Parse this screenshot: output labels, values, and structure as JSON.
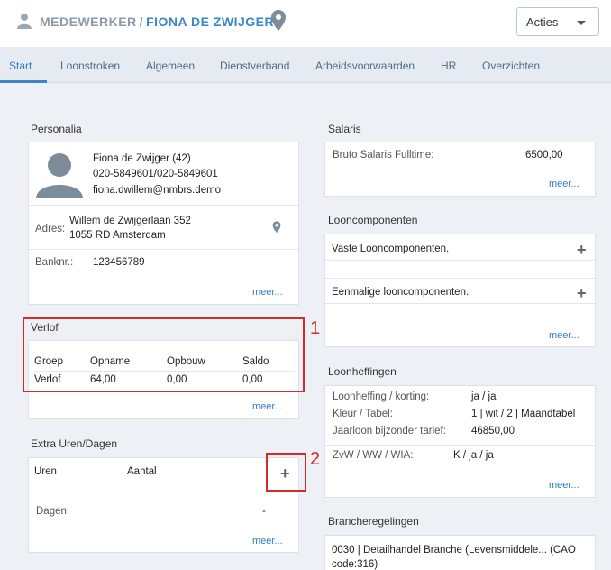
{
  "header": {
    "breadcrumb_root": "MEDEWERKER",
    "breadcrumb_sep": "/",
    "breadcrumb_current": "FIONA DE ZWIJGER",
    "acties_label": "Acties"
  },
  "tabs": [
    "Start",
    "Loonstroken",
    "Algemeen",
    "Dienstverband",
    "Arbeidsvoorwaarden",
    "HR",
    "Overzichten"
  ],
  "personalia": {
    "title": "Personalia",
    "name": "Fiona de Zwijger (42)",
    "phone": "020-5849601/020-5849601",
    "email": "fiona.dwillem@nmbrs.demo",
    "adres_label": "Adres:",
    "adres_line1": "Willem de Zwijgerlaan 352",
    "adres_line2": "1055 RD Amsterdam",
    "bank_label": "Banknr.:",
    "bank_value": "123456789",
    "meer": "meer..."
  },
  "verlof": {
    "title": "Verlof",
    "headers": [
      "Groep",
      "Opname",
      "Opbouw",
      "Saldo"
    ],
    "row": [
      "Verlof",
      "64,00",
      "0,00",
      "0,00"
    ],
    "meer": "meer..."
  },
  "extra": {
    "title": "Extra Uren/Dagen",
    "col_uren": "Uren",
    "col_aantal": "Aantal",
    "dagen_label": "Dagen:",
    "dagen_value": "-",
    "meer": "meer..."
  },
  "salaris": {
    "title": "Salaris",
    "label": "Bruto Salaris Fulltime:",
    "value": "6500,00",
    "meer": "meer..."
  },
  "looncomponenten": {
    "title": "Looncomponenten",
    "vaste": "Vaste Looncomponenten.",
    "eenmalige": "Eenmalige looncomponenten.",
    "meer": "meer..."
  },
  "loonheffingen": {
    "title": "Loonheffingen",
    "rows": [
      {
        "label": "Loonheffing / korting:",
        "value": "ja / ja"
      },
      {
        "label": "Kleur / Tabel:",
        "value": "1 | wit / 2 | Maandtabel"
      },
      {
        "label": "Jaarloon bijzonder tarief:",
        "value": "46850,00"
      }
    ],
    "zvw_label": "ZvW / WW / WIA:",
    "zvw_value": "K / ja / ja",
    "meer": "meer..."
  },
  "brancheregelingen": {
    "title": "Brancheregelingen",
    "line1": "0030 | Detailhandel Branche (Levensmiddele... (CAO",
    "line2": "code:316)"
  },
  "callouts": [
    "1",
    "2"
  ],
  "colors": {
    "accent": "#3a86c8",
    "callout": "#d42a2a",
    "background": "#edf1f5"
  }
}
